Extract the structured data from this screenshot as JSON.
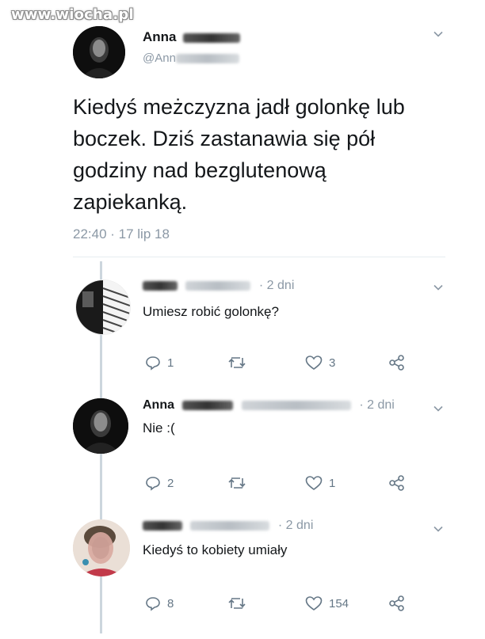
{
  "watermark": "www.wiocha.pl",
  "tweet": {
    "author_name": "Anna",
    "author_handle": "@Ann",
    "text": "Kiedyś meżczyzna jadł golonkę lub boczek. Dziś zastanawia się pół godziny nad bezglutenową zapiekanką.",
    "timestamp": "22:40 · 17 lip 18"
  },
  "replies": [
    {
      "name": "",
      "age": "· 2 dni",
      "text": "Umiesz robić golonkę?",
      "actions": {
        "reply_count": "1",
        "like_count": "3"
      }
    },
    {
      "name": "Anna",
      "age": "· 2 dni",
      "text": "Nie :(",
      "actions": {
        "reply_count": "2",
        "like_count": "1"
      }
    },
    {
      "name": "",
      "age": "· 2 dni",
      "text": "Kiedyś to kobiety umiały",
      "actions": {
        "reply_count": "8",
        "like_count": "154"
      }
    }
  ],
  "icons": [
    "chevron-down-icon",
    "reply-icon",
    "retweet-icon",
    "like-icon",
    "share-icon"
  ],
  "colors": {
    "text": "#14171a",
    "secondary": "#8b98a5",
    "divider": "#e6ecf0",
    "thread": "#ccd6dd"
  }
}
